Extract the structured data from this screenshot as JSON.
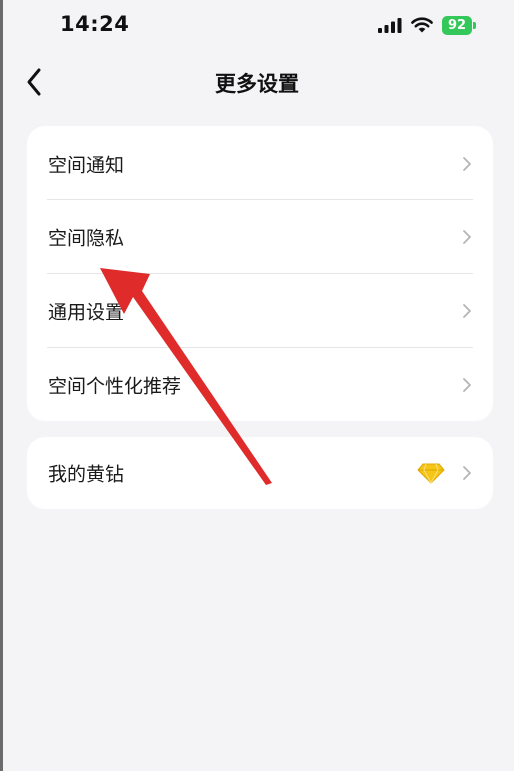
{
  "status_bar": {
    "time": "14:24",
    "battery": "92"
  },
  "nav": {
    "title": "更多设置"
  },
  "settings_group": {
    "items": [
      {
        "label": "空间通知"
      },
      {
        "label": "空间隐私"
      },
      {
        "label": "通用设置"
      },
      {
        "label": "空间个性化推荐"
      }
    ]
  },
  "vip_group": {
    "items": [
      {
        "label": "我的黄钻"
      }
    ]
  },
  "colors": {
    "background": "#f4f4f6",
    "card": "#ffffff",
    "battery": "#34c759",
    "annotation_arrow": "#e02b2b",
    "diamond": "#f5c518"
  },
  "icons": [
    "back-arrow-icon",
    "chevron-right-icon",
    "yellow-diamond-icon",
    "signal-icon",
    "wifi-icon",
    "battery-icon"
  ]
}
